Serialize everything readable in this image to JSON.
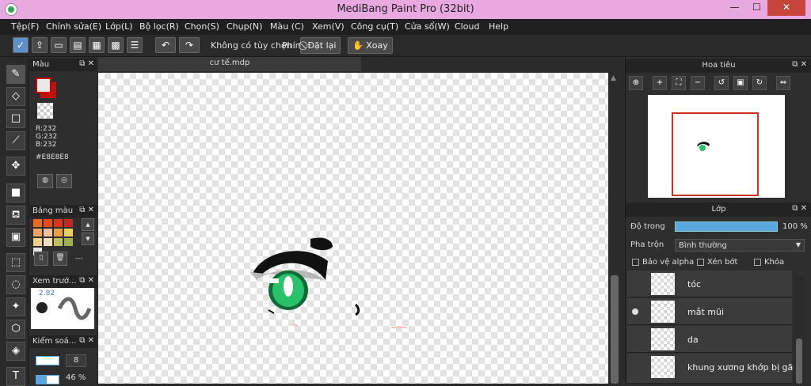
{
  "window": {
    "title": "MediBang Paint Pro (32bit)",
    "minimize": "—",
    "maximize": "☐",
    "close": "✕"
  },
  "menu": [
    "Tệp(F)",
    "Chỉnh sửa(E)",
    "Lớp(L)",
    "Bộ lọc(R)",
    "Chọn(S)",
    "Chụp(N)",
    "Màu (C)",
    "Xem(V)",
    "Công cụ(T)",
    "Cửa sổ(W)",
    "Cloud",
    "Help"
  ],
  "toolbar": {
    "no_selection": "Không có tùy chọn",
    "key_label": "Phím",
    "reset": "Đặt lại",
    "rotate": "Xoay"
  },
  "color_panel": {
    "title": "Màu",
    "r": "R:232",
    "g": "G:232",
    "b": "B:232",
    "hex": "#E8E8E8",
    "fg_color": "#E8E8E8",
    "bg_color": "#C01010"
  },
  "palette_panel": {
    "title": "Bảng màu",
    "colors": [
      "#e86a1f",
      "#e8481a",
      "#d8361a",
      "#c02a20",
      "#f0a060",
      "#f0c0a0",
      "#e8a040",
      "#e8d060",
      "#f0d090",
      "#f0e0c0",
      "#c0c060",
      "#a0b050",
      "#e0e0e0"
    ],
    "dash": "---"
  },
  "preview_panel": {
    "title": "Xem trướ...",
    "size": "2.82"
  },
  "control_panel": {
    "title": "Kiểm soá...",
    "brush_size": "8",
    "opacity": "46 %"
  },
  "canvas": {
    "tab": "cư tế.mdp"
  },
  "navigator": {
    "title": "Hoa tiêu"
  },
  "layers": {
    "title": "Lớp",
    "opacity_label": "Độ trong",
    "opacity_value": "100 %",
    "opacity_fraction": 1.0,
    "blend_label": "Pha trộn",
    "blend_value": "Bình thường",
    "protect_alpha": "Bảo vệ alpha",
    "clipping": "Xén bớt",
    "lock": "Khóa",
    "items": [
      {
        "name": "tóc",
        "visible": false
      },
      {
        "name": "mắt mũi",
        "visible": true
      },
      {
        "name": "da",
        "visible": false
      },
      {
        "name": "khung xương khớp bị gãy:",
        "visible": false
      }
    ]
  }
}
